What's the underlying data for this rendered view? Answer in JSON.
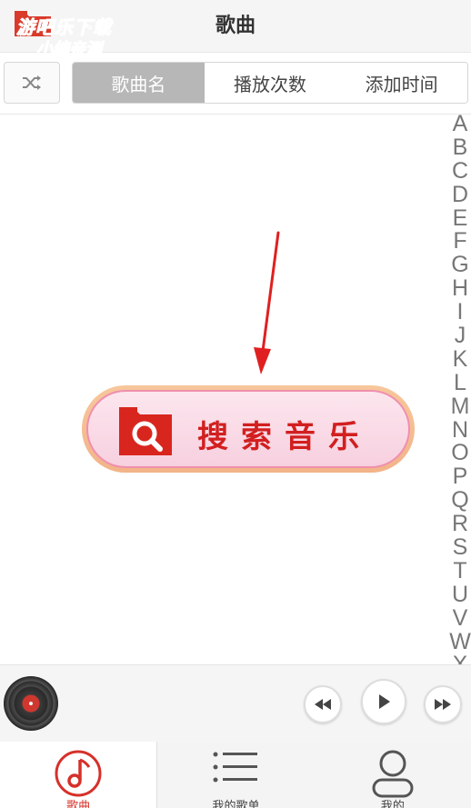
{
  "header": {
    "title": "歌曲",
    "watermark_line1": "游吧乐下载",
    "watermark_line2": "小编亲测"
  },
  "toolbar": {
    "shuffle_icon": "shuffle-icon",
    "tabs": [
      {
        "label": "歌曲名",
        "active": true
      },
      {
        "label": "播放次数",
        "active": false
      },
      {
        "label": "添加时间",
        "active": false
      }
    ]
  },
  "index_letters": [
    "A",
    "B",
    "C",
    "D",
    "E",
    "F",
    "G",
    "H",
    "I",
    "J",
    "K",
    "L",
    "M",
    "N",
    "O",
    "P",
    "Q",
    "R",
    "S",
    "T",
    "U",
    "V",
    "W",
    "X"
  ],
  "search_banner": {
    "label": "搜索音乐",
    "icon": "search-icon"
  },
  "player": {
    "controls": [
      "prev-icon",
      "play-icon",
      "next-icon"
    ]
  },
  "bottom_nav": [
    {
      "label": "歌曲",
      "icon": "music-note-icon",
      "active": true
    },
    {
      "label": "我的歌单",
      "icon": "list-icon",
      "active": false
    },
    {
      "label": "我的",
      "icon": "user-icon",
      "active": false
    }
  ],
  "colors": {
    "accent": "#d6302a",
    "tab_active": "#b7b7b7",
    "banner_border": "#f2b488",
    "banner_fill": "#fce6ee"
  }
}
